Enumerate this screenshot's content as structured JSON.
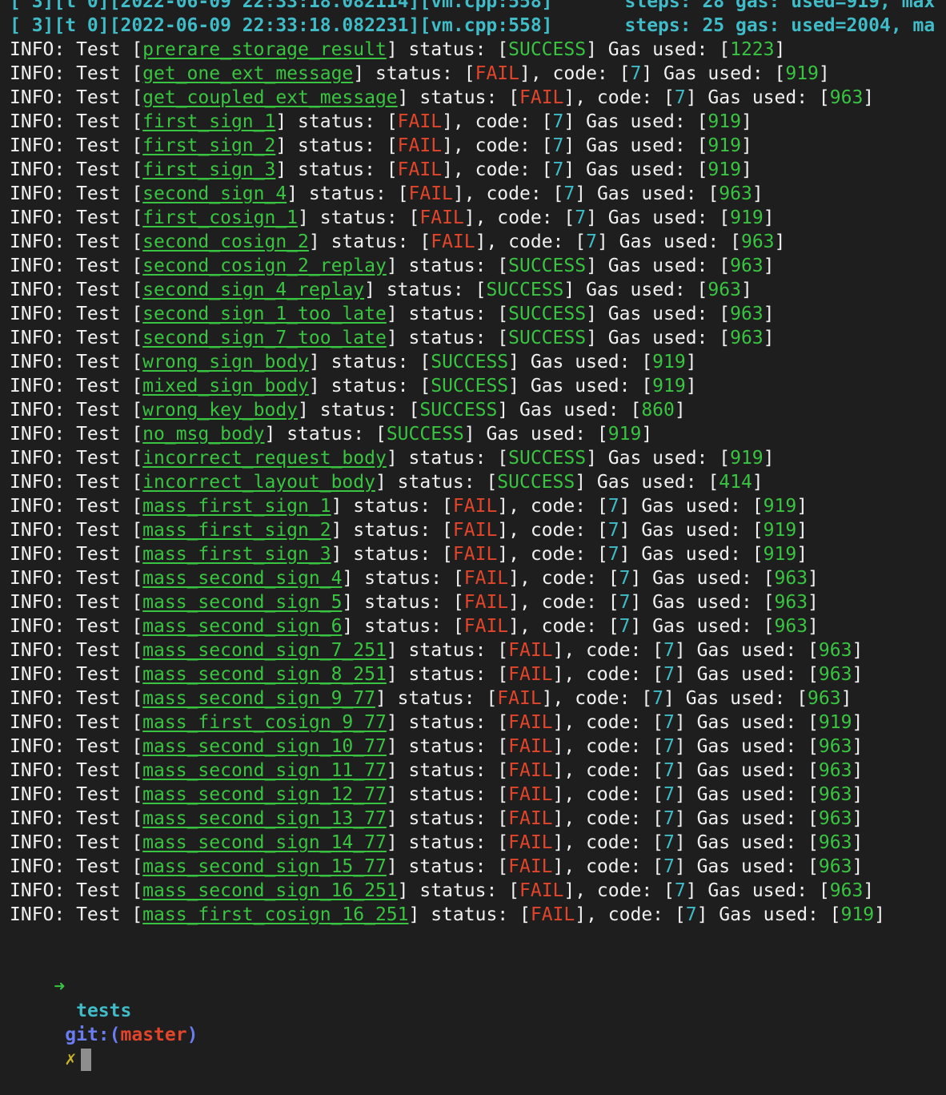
{
  "header_lines": [
    {
      "prefix": "[ 3][t 0][2022-06-09 22:33:18.082114][vm.cpp:558]",
      "suffix": "steps: 28 gas: used=919, max"
    },
    {
      "prefix": "[ 3][t 0][2022-06-09 22:33:18.082231][vm.cpp:558]",
      "suffix": "steps: 25 gas: used=2004, ma"
    }
  ],
  "labels": {
    "info": "INFO: Test [",
    "status": "] status: [",
    "code": "], code: [",
    "gas": "] Gas used: [",
    "end": "]"
  },
  "tests": [
    {
      "name": "prerare_storage_result",
      "status": "SUCCESS",
      "code": null,
      "gas": "1223"
    },
    {
      "name": "get_one_ext_message",
      "status": "FAIL",
      "code": "7",
      "gas": "919"
    },
    {
      "name": "get_coupled_ext_message",
      "status": "FAIL",
      "code": "7",
      "gas": "963"
    },
    {
      "name": "first_sign_1",
      "status": "FAIL",
      "code": "7",
      "gas": "919"
    },
    {
      "name": "first_sign_2",
      "status": "FAIL",
      "code": "7",
      "gas": "919"
    },
    {
      "name": "first_sign_3",
      "status": "FAIL",
      "code": "7",
      "gas": "919"
    },
    {
      "name": "second_sign_4",
      "status": "FAIL",
      "code": "7",
      "gas": "963"
    },
    {
      "name": "first_cosign_1",
      "status": "FAIL",
      "code": "7",
      "gas": "919"
    },
    {
      "name": "second_cosign_2",
      "status": "FAIL",
      "code": "7",
      "gas": "963"
    },
    {
      "name": "second_cosign_2_replay",
      "status": "SUCCESS",
      "code": null,
      "gas": "963"
    },
    {
      "name": "second_sign_4_replay",
      "status": "SUCCESS",
      "code": null,
      "gas": "963"
    },
    {
      "name": "second_sign_1_too_late",
      "status": "SUCCESS",
      "code": null,
      "gas": "963"
    },
    {
      "name": "second_sign_7_too_late",
      "status": "SUCCESS",
      "code": null,
      "gas": "963"
    },
    {
      "name": "wrong_sign_body",
      "status": "SUCCESS",
      "code": null,
      "gas": "919"
    },
    {
      "name": "mixed_sign_body",
      "status": "SUCCESS",
      "code": null,
      "gas": "919"
    },
    {
      "name": "wrong_key_body",
      "status": "SUCCESS",
      "code": null,
      "gas": "860"
    },
    {
      "name": "no_msg_body",
      "status": "SUCCESS",
      "code": null,
      "gas": "919"
    },
    {
      "name": "incorrect_request_body",
      "status": "SUCCESS",
      "code": null,
      "gas": "919"
    },
    {
      "name": "incorrect_layout_body",
      "status": "SUCCESS",
      "code": null,
      "gas": "414"
    },
    {
      "name": "mass_first_sign_1",
      "status": "FAIL",
      "code": "7",
      "gas": "919"
    },
    {
      "name": "mass_first_sign_2",
      "status": "FAIL",
      "code": "7",
      "gas": "919"
    },
    {
      "name": "mass_first_sign_3",
      "status": "FAIL",
      "code": "7",
      "gas": "919"
    },
    {
      "name": "mass_second_sign_4",
      "status": "FAIL",
      "code": "7",
      "gas": "963"
    },
    {
      "name": "mass_second_sign_5",
      "status": "FAIL",
      "code": "7",
      "gas": "963"
    },
    {
      "name": "mass_second_sign_6",
      "status": "FAIL",
      "code": "7",
      "gas": "963"
    },
    {
      "name": "mass_second_sign_7_251",
      "status": "FAIL",
      "code": "7",
      "gas": "963"
    },
    {
      "name": "mass_second_sign_8_251",
      "status": "FAIL",
      "code": "7",
      "gas": "963"
    },
    {
      "name": "mass_second_sign_9_77",
      "status": "FAIL",
      "code": "7",
      "gas": "963"
    },
    {
      "name": "mass_first_cosign_9_77",
      "status": "FAIL",
      "code": "7",
      "gas": "919"
    },
    {
      "name": "mass_second_sign_10_77",
      "status": "FAIL",
      "code": "7",
      "gas": "963"
    },
    {
      "name": "mass_second_sign_11_77",
      "status": "FAIL",
      "code": "7",
      "gas": "963"
    },
    {
      "name": "mass_second_sign_12_77",
      "status": "FAIL",
      "code": "7",
      "gas": "963"
    },
    {
      "name": "mass_second_sign_13_77",
      "status": "FAIL",
      "code": "7",
      "gas": "963"
    },
    {
      "name": "mass_second_sign_14_77",
      "status": "FAIL",
      "code": "7",
      "gas": "963"
    },
    {
      "name": "mass_second_sign_15_77",
      "status": "FAIL",
      "code": "7",
      "gas": "963"
    },
    {
      "name": "mass_second_sign_16_251",
      "status": "FAIL",
      "code": "7",
      "gas": "963"
    },
    {
      "name": "mass_first_cosign_16_251",
      "status": "FAIL",
      "code": "7",
      "gas": "919"
    }
  ],
  "prompt": {
    "arrow": "➜",
    "directory": "tests",
    "git_label": "git:(",
    "branch": "master",
    "git_close": ")",
    "dirty_marker": "✗"
  },
  "colors": {
    "background": "#1e1e1e",
    "text": "#f0f0f0",
    "green": "#39c441",
    "red": "#e3452b",
    "cyan": "#3fbcc8",
    "blue": "#6b7cf0",
    "yellow": "#c9b22d"
  }
}
